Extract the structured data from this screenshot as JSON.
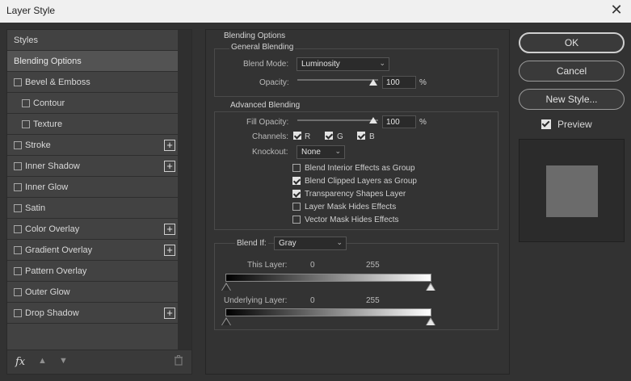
{
  "window": {
    "title": "Layer Style",
    "close_glyph": "✕"
  },
  "sidebar": {
    "header": "Styles",
    "items": [
      {
        "label": "Blending Options",
        "selected": true,
        "checkbox": false,
        "plus": false
      },
      {
        "label": "Bevel & Emboss",
        "checkbox": true,
        "checked": false,
        "plus": false
      },
      {
        "label": "Contour",
        "checkbox": true,
        "checked": false,
        "sub": true,
        "plus": false
      },
      {
        "label": "Texture",
        "checkbox": true,
        "checked": false,
        "sub": true,
        "plus": false
      },
      {
        "label": "Stroke",
        "checkbox": true,
        "checked": false,
        "plus": true
      },
      {
        "label": "Inner Shadow",
        "checkbox": true,
        "checked": false,
        "plus": true
      },
      {
        "label": "Inner Glow",
        "checkbox": true,
        "checked": false,
        "plus": false
      },
      {
        "label": "Satin",
        "checkbox": true,
        "checked": false,
        "plus": false
      },
      {
        "label": "Color Overlay",
        "checkbox": true,
        "checked": false,
        "plus": true
      },
      {
        "label": "Gradient Overlay",
        "checkbox": true,
        "checked": false,
        "plus": true
      },
      {
        "label": "Pattern Overlay",
        "checkbox": true,
        "checked": false,
        "plus": false
      },
      {
        "label": "Outer Glow",
        "checkbox": true,
        "checked": false,
        "plus": false
      },
      {
        "label": "Drop Shadow",
        "checkbox": true,
        "checked": false,
        "plus": true
      }
    ],
    "footer": {
      "fx": "fx",
      "up_icon": "arrow-up-icon",
      "down_icon": "arrow-down-icon",
      "trash_icon": "trash-icon"
    }
  },
  "blending": {
    "title": "Blending Options",
    "general": {
      "legend": "General Blending",
      "blend_mode_label": "Blend Mode:",
      "blend_mode_value": "Luminosity",
      "opacity_label": "Opacity:",
      "opacity_value": "100",
      "percent": "%"
    },
    "advanced": {
      "legend": "Advanced Blending",
      "fill_opacity_label": "Fill Opacity:",
      "fill_opacity_value": "100",
      "percent": "%",
      "channels_label": "Channels:",
      "channels": [
        {
          "label": "R",
          "checked": true
        },
        {
          "label": "G",
          "checked": true
        },
        {
          "label": "B",
          "checked": true
        }
      ],
      "knockout_label": "Knockout:",
      "knockout_value": "None",
      "options": [
        {
          "label": "Blend Interior Effects as Group",
          "checked": false
        },
        {
          "label": "Blend Clipped Layers as Group",
          "checked": true
        },
        {
          "label": "Transparency Shapes Layer",
          "checked": true
        },
        {
          "label": "Layer Mask Hides Effects",
          "checked": false
        },
        {
          "label": "Vector Mask Hides Effects",
          "checked": false
        }
      ]
    },
    "blend_if": {
      "label": "Blend If:",
      "value": "Gray",
      "this_layer_label": "This Layer:",
      "this_layer_min": "0",
      "this_layer_max": "255",
      "underlying_label": "Underlying Layer:",
      "underlying_min": "0",
      "underlying_max": "255"
    }
  },
  "buttons": {
    "ok": "OK",
    "cancel": "Cancel",
    "new_style": "New Style..."
  },
  "preview": {
    "label": "Preview",
    "checked": true,
    "swatch_color": "#6b6b6b"
  }
}
